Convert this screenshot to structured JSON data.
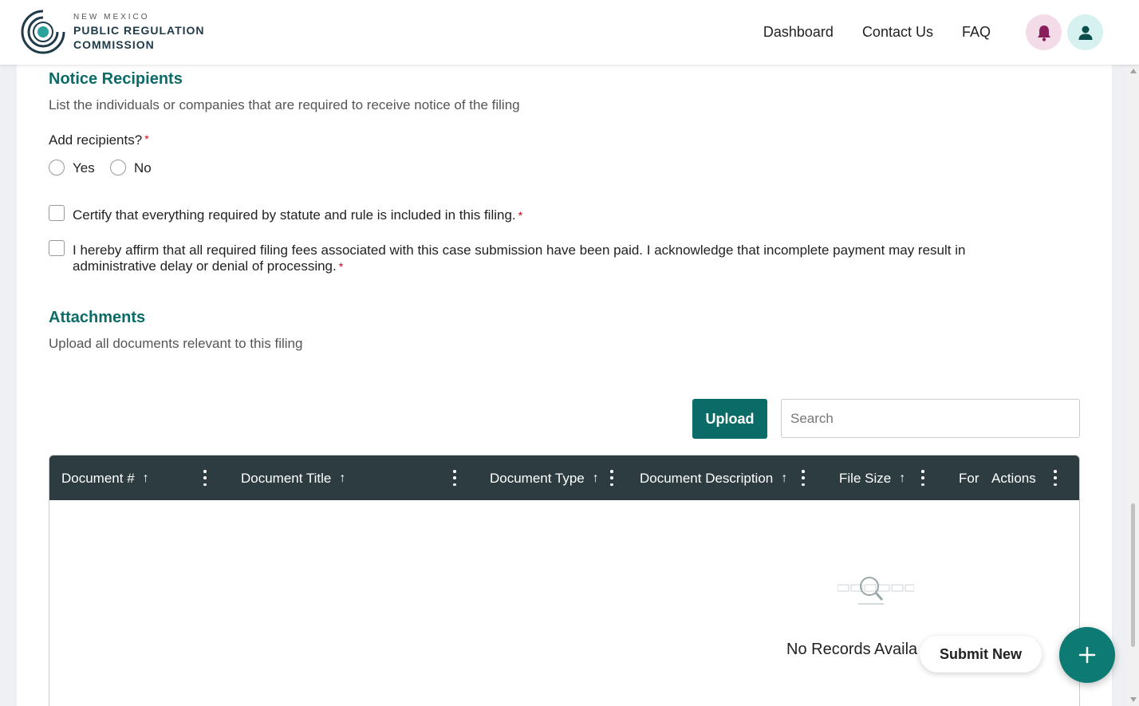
{
  "header": {
    "logo": {
      "line1": "NEW MEXICO",
      "line2": "PUBLIC REGULATION",
      "line3": "COMMISSION"
    },
    "nav": [
      "Dashboard",
      "Contact Us",
      "FAQ"
    ],
    "icons": {
      "notifications": "bell-icon",
      "profile": "user-icon"
    }
  },
  "notice": {
    "title": "Notice Recipients",
    "description": "List the individuals or companies that are required to receive notice of the filing",
    "question": "Add recipients?",
    "required_mark": "*",
    "options": [
      "Yes",
      "No"
    ]
  },
  "certify": {
    "statement1": "Certify that everything required by statute and rule is included in this filing.",
    "statement2_line1": "I hereby affirm that all required filing fees associated with this case submission have been paid. I acknowledge that incomplete payment may result in",
    "statement2_line2": "administrative delay or denial of processing."
  },
  "attachments": {
    "title": "Attachments",
    "description": "Upload all documents relevant to this filing",
    "upload_label": "Upload",
    "search_placeholder": "Search",
    "columns": [
      "Document #",
      "Document Title",
      "Document Type",
      "Document Description",
      "File Size",
      "For",
      "Actions"
    ],
    "empty_text": "No Records Availa"
  },
  "fab": {
    "label": "Submit New",
    "icon": "plus-icon"
  },
  "colors": {
    "accent": "#0b6b66",
    "table_header": "#2c3c40",
    "required": "#d0021b"
  }
}
